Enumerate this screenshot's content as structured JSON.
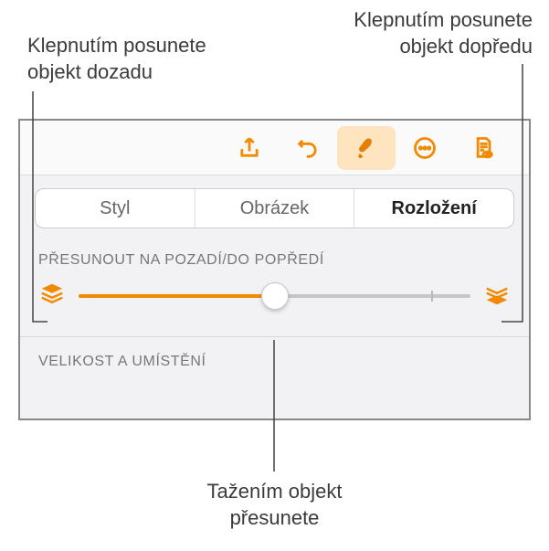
{
  "callouts": {
    "back_line1": "Klepnutím posunete",
    "back_line2": "objekt dozadu",
    "front_line1": "Klepnutím posunete",
    "front_line2": "objekt dopředu",
    "drag_line1": "Tažením objekt",
    "drag_line2": "přesunete"
  },
  "tabs": {
    "style": "Styl",
    "image": "Obrázek",
    "layout": "Rozložení"
  },
  "section_labels": {
    "back_front": "PŘESUNOUT NA POZADÍ/DO POPŘEDÍ",
    "size_position": "VELIKOST A UMÍSTĚNÍ"
  },
  "slider": {
    "value_percent": 50,
    "tick_percent": 90
  },
  "colors": {
    "accent": "#f08a00"
  }
}
